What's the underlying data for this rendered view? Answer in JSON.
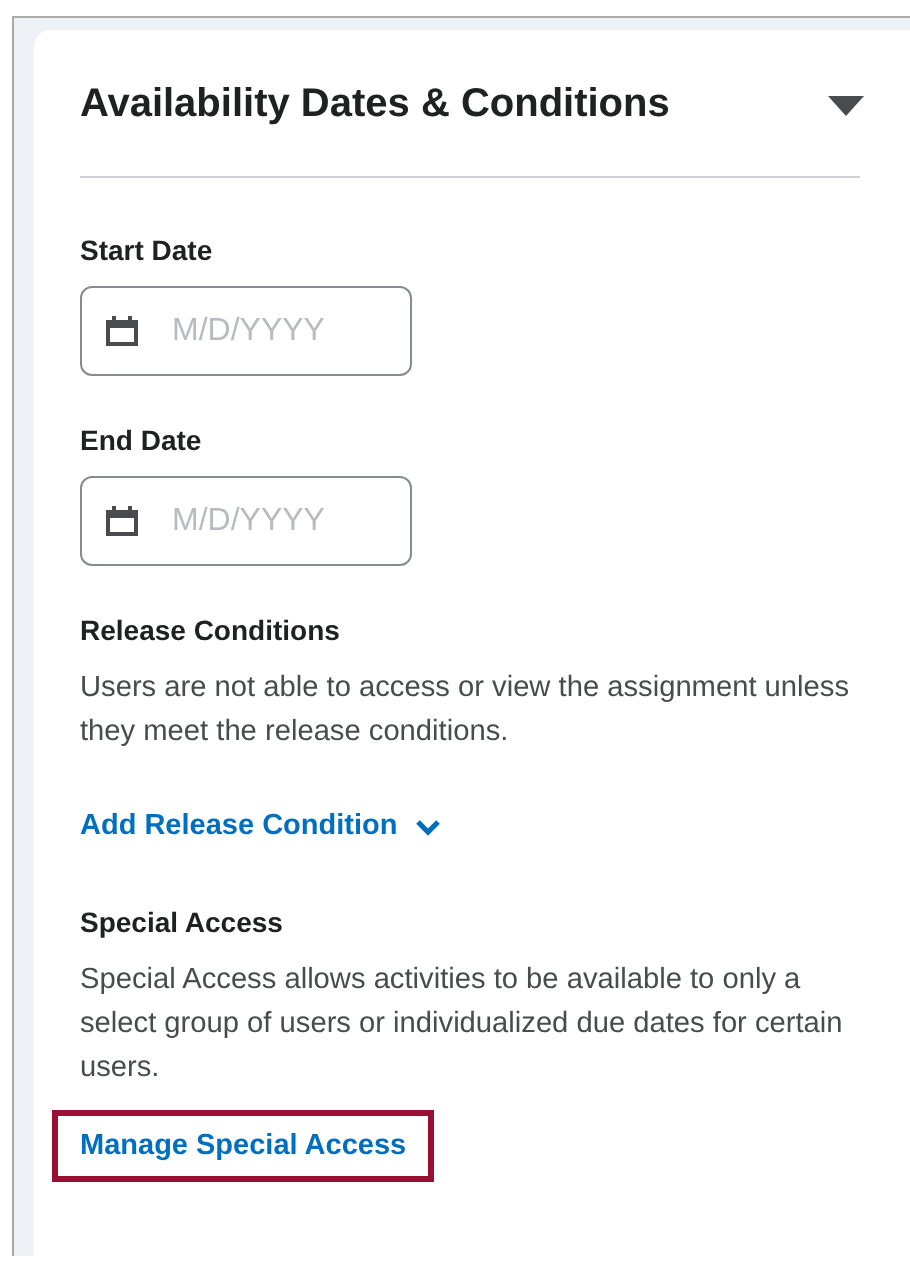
{
  "panel": {
    "title": "Availability Dates & Conditions",
    "expanded": true
  },
  "date_fields": [
    {
      "label": "Start Date",
      "placeholder": "M/D/YYYY"
    },
    {
      "label": "End Date",
      "placeholder": "M/D/YYYY"
    }
  ],
  "sections": [
    {
      "heading": "Release Conditions",
      "description": "Users are not able to access or view the assignment unless they meet the release conditions.",
      "link": "Add Release Condition",
      "link_has_dropdown": true,
      "highlighted": false
    },
    {
      "heading": "Special Access",
      "description": "Special Access allows activities to be available to only a select group of users or individualized due dates for certain users.",
      "link": "Manage Special Access",
      "link_has_dropdown": false,
      "highlighted": true
    }
  ]
}
